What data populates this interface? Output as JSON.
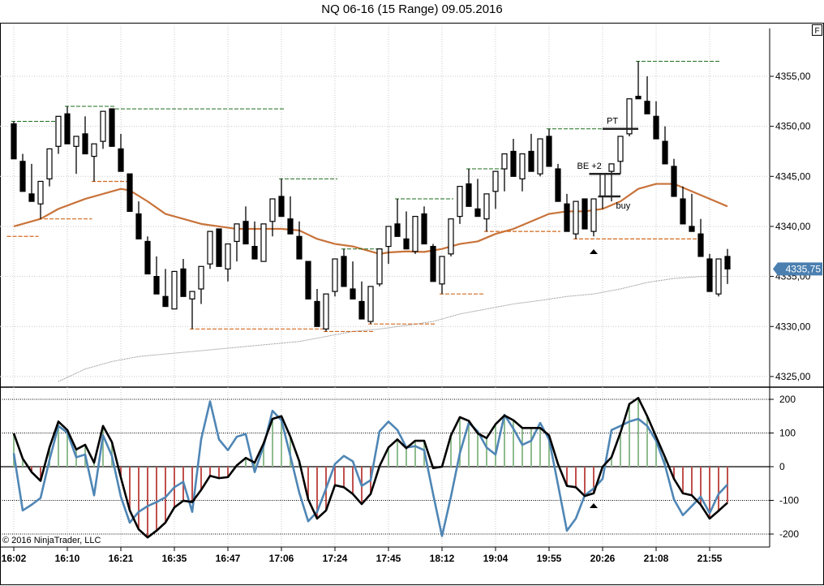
{
  "header": {
    "title": "NQ 06-16 (15 Range)  09.05.2016",
    "f_button": "F"
  },
  "copyright": "© 2016 NinjaTrader, LLC",
  "colors": {
    "up_candle": "#ffffff",
    "down_candle": "#000000",
    "fast_ma": "#c8733a",
    "slow_ma": "#808080",
    "swing_high": "#1e6e1e",
    "swing_low": "#d2691e",
    "hist_pos": "#8fbc8f",
    "hist_neg": "#c0504d",
    "osc_main": "#000000",
    "osc_signal": "#4f86b5",
    "last_price_badge": "#4a7fb0"
  },
  "chart_data": [
    {
      "type": "candlestick",
      "title": "NQ 06-16 (15 Range)  09.05.2016",
      "ylim": [
        4324,
        4360.2
      ],
      "y_ticks": [
        "4355,00",
        "4350,00",
        "4345,00",
        "4340,00",
        "4335,00",
        "4330,00",
        "4325,00"
      ],
      "y_tick_values": [
        4355,
        4350,
        4345,
        4340,
        4335,
        4330,
        4325
      ],
      "last_price": "4335,75",
      "last_price_value": 4335.75,
      "grid": true,
      "x_ticks": [
        "16:02",
        "16:10",
        "16:21",
        "16:35",
        "16:47",
        "17:06",
        "17:24",
        "17:45",
        "18:12",
        "19:04",
        "19:55",
        "20:26",
        "21:08",
        "21:55"
      ],
      "x_tick_bar_step": 6,
      "ohlc": [
        [
          4350.25,
          4350.5,
          4346.75,
          4346.75
        ],
        [
          4346.5,
          4347.25,
          4343.5,
          4343.5
        ],
        [
          4343.25,
          4346.25,
          4342.5,
          4342.5
        ],
        [
          4342.25,
          4344.5,
          4340.75,
          4344.5
        ],
        [
          4344.75,
          4347.75,
          4344,
          4347.75
        ],
        [
          4348,
          4351,
          4347.25,
          4351
        ],
        [
          4351.25,
          4352,
          4348.25,
          4348.25
        ],
        [
          4348,
          4349,
          4345.25,
          4349
        ],
        [
          4349.25,
          4351,
          4347.25,
          4347.25
        ],
        [
          4347,
          4348.25,
          4344.5,
          4348.25
        ],
        [
          4348.5,
          4351.5,
          4347.75,
          4351.5
        ],
        [
          4351.75,
          4351.75,
          4348,
          4348
        ],
        [
          4347.75,
          4349.25,
          4345.5,
          4345.5
        ],
        [
          4345.25,
          4345.25,
          4341.5,
          4341.5
        ],
        [
          4341.25,
          4342.5,
          4338.75,
          4338.75
        ],
        [
          4338.5,
          4339,
          4335.25,
          4335.25
        ],
        [
          4335,
          4337,
          4333.25,
          4333.25
        ],
        [
          4333,
          4335.75,
          4332,
          4332
        ],
        [
          4331.75,
          4335.5,
          4331.75,
          4335.5
        ],
        [
          4335.75,
          4336.75,
          4333,
          4333
        ],
        [
          4332.75,
          4333.5,
          4329.75,
          4333.5
        ],
        [
          4333.75,
          4336,
          4332.25,
          4336
        ],
        [
          4336.25,
          4339.5,
          4335.75,
          4339.5
        ],
        [
          4339.75,
          4339.75,
          4336,
          4336
        ],
        [
          4335.75,
          4338.25,
          4334.5,
          4338.25
        ],
        [
          4338.5,
          4340.25,
          4336.5,
          4340.25
        ],
        [
          4340.5,
          4342,
          4338.25,
          4338.25
        ],
        [
          4338,
          4340.5,
          4336.75,
          4336.75
        ],
        [
          4336.5,
          4340.25,
          4336.5,
          4340.25
        ],
        [
          4340.5,
          4342.75,
          4339,
          4342.75
        ],
        [
          4343,
          4344.75,
          4341,
          4341
        ],
        [
          4340.75,
          4343,
          4339.25,
          4339.25
        ],
        [
          4339,
          4340.5,
          4336.75,
          4336.75
        ],
        [
          4336.5,
          4336.5,
          4332.75,
          4332.75
        ],
        [
          4332.5,
          4333.75,
          4330,
          4330
        ],
        [
          4329.75,
          4333.25,
          4329.5,
          4333.25
        ],
        [
          4333.5,
          4336.75,
          4333,
          4336.75
        ],
        [
          4337,
          4337.75,
          4334,
          4334
        ],
        [
          4333.75,
          4336.5,
          4332.75,
          4332.75
        ],
        [
          4332.5,
          4334.5,
          4330.75,
          4330.75
        ],
        [
          4330.5,
          4334,
          4330.25,
          4334
        ],
        [
          4334.25,
          4337.75,
          4334,
          4337.75
        ],
        [
          4338,
          4340,
          4336.25,
          4340
        ],
        [
          4340.25,
          4342.75,
          4339,
          4339
        ],
        [
          4338.75,
          4341.5,
          4337.75,
          4337.75
        ],
        [
          4337.5,
          4341,
          4337.25,
          4341
        ],
        [
          4341.25,
          4342,
          4338.25,
          4338.25
        ],
        [
          4338,
          4338.25,
          4334.5,
          4334.5
        ],
        [
          4334.25,
          4337,
          4333.25,
          4337
        ],
        [
          4337.25,
          4340.75,
          4337,
          4340.75
        ],
        [
          4341,
          4344,
          4340.25,
          4344
        ],
        [
          4344.25,
          4345.75,
          4342,
          4342
        ],
        [
          4341.75,
          4344.75,
          4341,
          4341
        ],
        [
          4340.75,
          4343.25,
          4339.5,
          4343.25
        ],
        [
          4343.5,
          4345.5,
          4341.75,
          4345.5
        ],
        [
          4345.75,
          4347.25,
          4343.5,
          4347.25
        ],
        [
          4347.5,
          4348.75,
          4345,
          4345
        ],
        [
          4344.75,
          4347.25,
          4343.5,
          4347.25
        ],
        [
          4347.5,
          4349.25,
          4345.5,
          4345.5
        ],
        [
          4345.25,
          4348.75,
          4345,
          4348.75
        ],
        [
          4349,
          4349.75,
          4346,
          4346
        ],
        [
          4345.75,
          4346.25,
          4342.5,
          4342.5
        ],
        [
          4342.25,
          4343.25,
          4339.5,
          4339.5
        ],
        [
          4339.25,
          4342.5,
          4338.75,
          4342.5
        ],
        [
          4342.75,
          4342.75,
          4339.75,
          4339.75
        ],
        [
          4339.5,
          4342.75,
          4339,
          4342.75
        ],
        [
          4343,
          4345.25,
          4341.75,
          4345.25
        ],
        [
          4345.5,
          4346.25,
          4342.5,
          4346.25
        ],
        [
          4346.5,
          4349,
          4345.25,
          4349
        ],
        [
          4349.25,
          4352.75,
          4349,
          4352.75
        ],
        [
          4353,
          4356.5,
          4352.75,
          4352.75
        ],
        [
          4352.5,
          4355,
          4351.25,
          4351.25
        ],
        [
          4351,
          4352.5,
          4348.75,
          4348.75
        ],
        [
          4348.5,
          4350,
          4346.25,
          4346.25
        ],
        [
          4346,
          4346.75,
          4343,
          4343
        ],
        [
          4342.75,
          4344,
          4340.25,
          4340.25
        ],
        [
          4340,
          4343.25,
          4339.5,
          4339.5
        ],
        [
          4339.25,
          4340.75,
          4337,
          4337
        ],
        [
          4336.75,
          4337.25,
          4333.5,
          4333.5
        ],
        [
          4333.25,
          4336.75,
          4333,
          4336.75
        ],
        [
          4337,
          4337.75,
          4334.25,
          4335.75
        ]
      ],
      "fast_ma": [
        [
          0,
          4340
        ],
        [
          3,
          4340.75
        ],
        [
          5,
          4341.75
        ],
        [
          8,
          4342.75
        ],
        [
          11,
          4343.5
        ],
        [
          12,
          4343.75
        ],
        [
          13,
          4343.6
        ],
        [
          15,
          4342.5
        ],
        [
          17,
          4341.25
        ],
        [
          19,
          4340.75
        ],
        [
          21,
          4340.25
        ],
        [
          23,
          4340
        ],
        [
          25,
          4339.75
        ],
        [
          30,
          4339.75
        ],
        [
          32,
          4339.6
        ],
        [
          34,
          4338.75
        ],
        [
          36,
          4338.25
        ],
        [
          38,
          4338
        ],
        [
          39,
          4337.75
        ],
        [
          41,
          4337.25
        ],
        [
          42,
          4337.4
        ],
        [
          44,
          4337.5
        ],
        [
          46,
          4337.45
        ],
        [
          48,
          4337.75
        ],
        [
          50,
          4338.25
        ],
        [
          52,
          4338.5
        ],
        [
          54,
          4339.25
        ],
        [
          56,
          4339.75
        ],
        [
          58,
          4340.5
        ],
        [
          60,
          4341.25
        ],
        [
          62,
          4341.5
        ],
        [
          64,
          4341.5
        ],
        [
          66,
          4341.75
        ],
        [
          68,
          4342.5
        ],
        [
          70,
          4343.75
        ],
        [
          72,
          4344.25
        ],
        [
          74,
          4344.25
        ],
        [
          76,
          4343.5
        ],
        [
          78,
          4342.75
        ],
        [
          80,
          4342
        ]
      ],
      "slow_ma": [
        [
          5,
          4324.5
        ],
        [
          8,
          4325.75
        ],
        [
          11,
          4326.5
        ],
        [
          14,
          4327
        ],
        [
          17,
          4327.25
        ],
        [
          20,
          4327.5
        ],
        [
          23,
          4327.75
        ],
        [
          26,
          4328
        ],
        [
          29,
          4328.25
        ],
        [
          32,
          4328.5
        ],
        [
          35,
          4329
        ],
        [
          38,
          4329.5
        ],
        [
          41,
          4329.75
        ],
        [
          44,
          4330.1
        ],
        [
          47,
          4330.5
        ],
        [
          50,
          4331.25
        ],
        [
          53,
          4331.75
        ],
        [
          56,
          4332.25
        ],
        [
          59,
          4332.6
        ],
        [
          62,
          4333
        ],
        [
          65,
          4333.25
        ],
        [
          68,
          4333.75
        ],
        [
          71,
          4334.4
        ],
        [
          74,
          4334.8
        ],
        [
          77,
          4335
        ],
        [
          80,
          4335
        ]
      ],
      "swing_highs": [
        [
          0,
          5,
          4350.5
        ],
        [
          6,
          11,
          4352
        ],
        [
          11,
          30,
          4351.75
        ],
        [
          30,
          36,
          4344.75
        ],
        [
          37,
          41,
          4337.75
        ],
        [
          43,
          49,
          4342.75
        ],
        [
          51,
          55,
          4345.75
        ],
        [
          60,
          66,
          4349.75
        ],
        [
          70,
          79,
          4356.5
        ]
      ],
      "swing_lows": [
        [
          -0.5,
          2.5,
          4339
        ],
        [
          3,
          8.5,
          4340.75
        ],
        [
          9,
          12.5,
          4344.5
        ],
        [
          20,
          35,
          4329.75
        ],
        [
          35,
          40,
          4329.5
        ],
        [
          40,
          47,
          4330.25
        ],
        [
          48,
          52.5,
          4333.25
        ],
        [
          53,
          61,
          4339.5
        ],
        [
          63,
          76.5,
          4338.75
        ]
      ],
      "trade_lines": [
        {
          "label": "PT",
          "price": 4349.75,
          "from_bar": 66,
          "to_bar": 70
        },
        {
          "label": "BE +2",
          "price": 4345.25,
          "from_bar": 64.5,
          "to_bar": 68
        },
        {
          "label": "buy",
          "price": 4343,
          "from_bar": 65.5,
          "to_bar": 68
        }
      ],
      "entry_marker_bar": 65
    },
    {
      "type": "line",
      "ylim": [
        -235,
        235
      ],
      "y_ticks": [
        "200",
        "100",
        "0",
        "-100",
        "-200"
      ],
      "y_tick_values": [
        200,
        100,
        0,
        -100,
        -200
      ],
      "histogram_of": "main",
      "series": [
        {
          "values": [
            99,
            24,
            -16,
            -42,
            57,
            134,
            109,
            51,
            65,
            12,
            121,
            73,
            -32,
            -130,
            -186,
            -210,
            -190,
            -166,
            -121,
            -101,
            -105,
            -69,
            -27,
            -34,
            -31,
            4,
            26,
            12,
            69,
            142,
            150,
            89,
            16,
            -97,
            -154,
            -130,
            -55,
            -61,
            -81,
            -111,
            -81,
            2,
            57,
            81,
            55,
            77,
            77,
            -4,
            0,
            93,
            147,
            136,
            99,
            85,
            126,
            152,
            138,
            115,
            115,
            115,
            93,
            8,
            -57,
            -61,
            -87,
            -79,
            0,
            28,
            101,
            186,
            204,
            150,
            89,
            28,
            -36,
            -79,
            -85,
            -113,
            -154,
            -131,
            -107
          ]
        },
        {
          "values": [
            40,
            -130,
            -113,
            -93,
            20,
            121,
            101,
            28,
            36,
            -85,
            93,
            32,
            -89,
            -166,
            -134,
            -117,
            -105,
            -91,
            -61,
            -45,
            -134,
            81,
            194,
            81,
            49,
            89,
            97,
            -16,
            61,
            166,
            138,
            32,
            -77,
            -162,
            -134,
            -65,
            8,
            32,
            16,
            -57,
            -40,
            105,
            134,
            109,
            57,
            61,
            49,
            -81,
            -206,
            -89,
            40,
            130,
            105,
            57,
            36,
            154,
            113,
            65,
            77,
            130,
            81,
            -53,
            -190,
            -154,
            -85,
            -65,
            -36,
            109,
            121,
            134,
            142,
            121,
            77,
            4,
            -97,
            -144,
            -117,
            -89,
            -138,
            -81,
            -53
          ]
        }
      ],
      "entry_marker_bar": 65
    }
  ]
}
